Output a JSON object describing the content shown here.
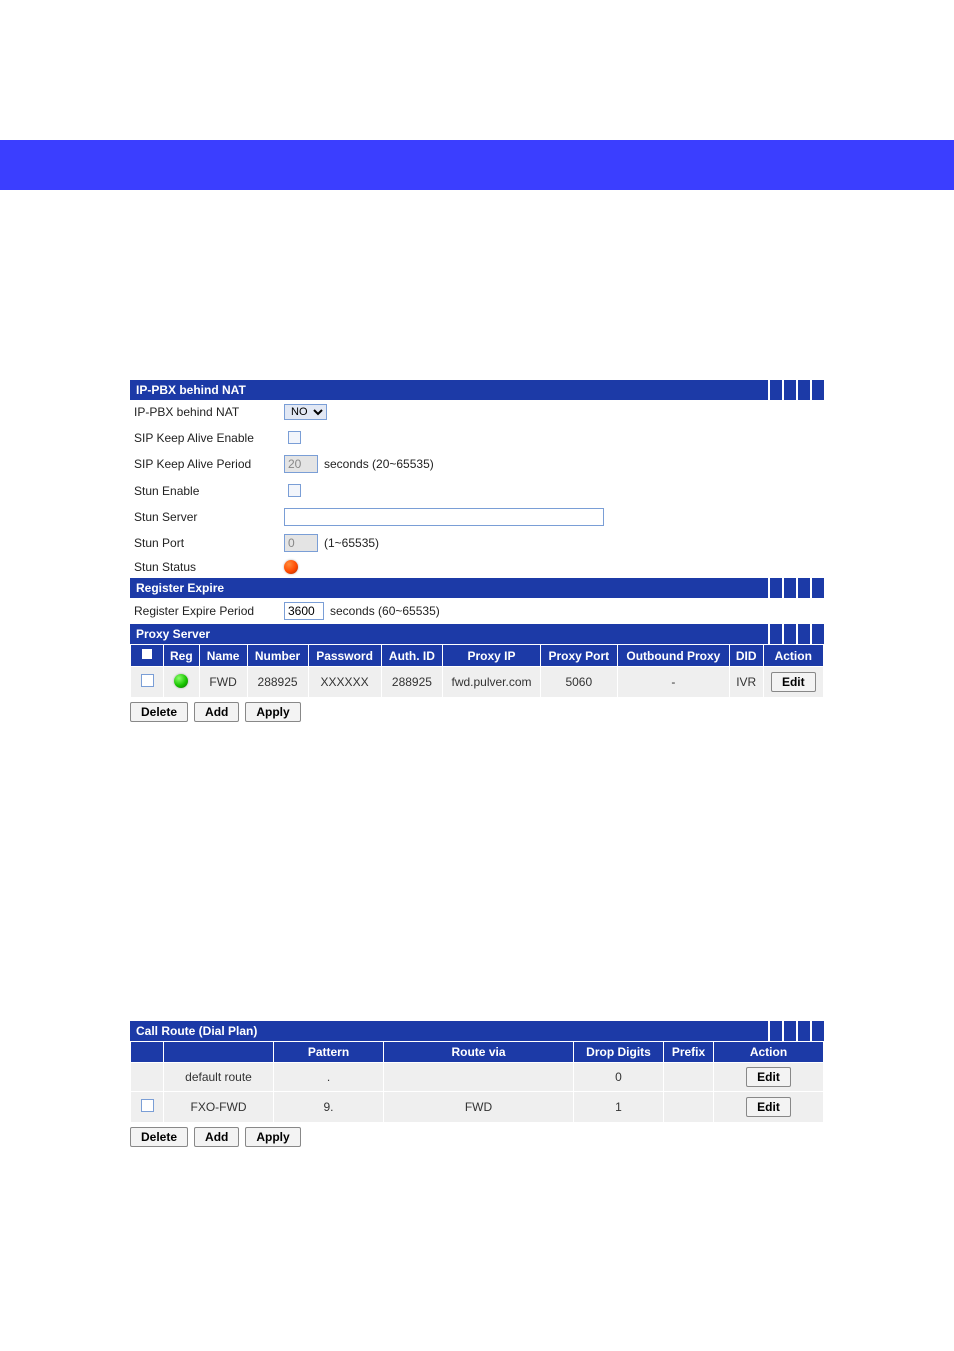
{
  "sections": {
    "nat": {
      "title": "IP-PBX behind NAT",
      "rows": {
        "behind_nat_label": "IP-PBX behind NAT",
        "behind_nat_value": "NO",
        "keepalive_enable_label": "SIP Keep Alive Enable",
        "keepalive_period_label": "SIP Keep Alive Period",
        "keepalive_period_value": "20",
        "keepalive_period_hint": "seconds (20~65535)",
        "stun_enable_label": "Stun Enable",
        "stun_server_label": "Stun Server",
        "stun_server_value": "",
        "stun_port_label": "Stun Port",
        "stun_port_value": "0",
        "stun_port_hint": "(1~65535)",
        "stun_status_label": "Stun Status"
      }
    },
    "register": {
      "title": "Register Expire",
      "period_label": "Register Expire Period",
      "period_value": "3600",
      "period_hint": "seconds (60~65535)"
    },
    "proxy": {
      "title": "Proxy Server",
      "headers": {
        "reg": "Reg",
        "name": "Name",
        "number": "Number",
        "password": "Password",
        "auth": "Auth. ID",
        "proxy_ip": "Proxy IP",
        "proxy_port": "Proxy Port",
        "outbound": "Outbound Proxy",
        "did": "DID",
        "action": "Action"
      },
      "rows": [
        {
          "name": "FWD",
          "number": "288925",
          "password": "XXXXXX",
          "auth": "288925",
          "proxy_ip": "fwd.pulver.com",
          "proxy_port": "5060",
          "outbound": "-",
          "did": "IVR"
        }
      ]
    },
    "dialplan": {
      "title": "Call Route (Dial Plan)",
      "headers": {
        "name": "",
        "pattern": "Pattern",
        "route_via": "Route via",
        "drop_digits": "Drop Digits",
        "prefix": "Prefix",
        "action": "Action"
      },
      "rows": [
        {
          "name": "default route",
          "pattern": ".",
          "route_via": "",
          "drop_digits": "0",
          "prefix": ""
        },
        {
          "name": "FXO-FWD",
          "pattern": "9.",
          "route_via": "FWD",
          "drop_digits": "1",
          "prefix": ""
        }
      ]
    }
  },
  "buttons": {
    "delete": "Delete",
    "add": "Add",
    "apply": "Apply",
    "edit": "Edit"
  }
}
